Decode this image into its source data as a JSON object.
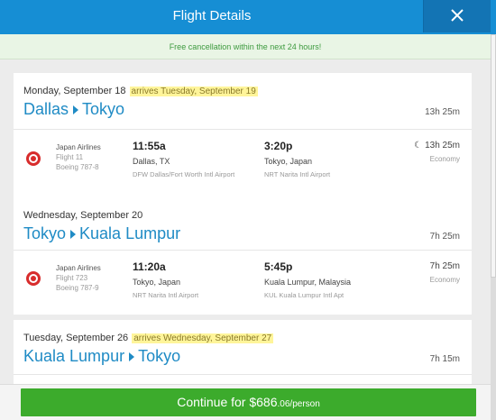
{
  "header": {
    "title": "Flight Details",
    "close_icon": "close-icon"
  },
  "notice": {
    "text": "Free cancellation within the next 24 hours!"
  },
  "cards": [
    {
      "date": "Monday, September 18",
      "arrives": "arrives Tuesday, September 19",
      "from": "Dallas",
      "to": "Tokyo",
      "duration": "13h 25m",
      "segment": {
        "airline": "Japan Airlines",
        "flight": "Flight 11",
        "aircraft": "Boeing 787-8",
        "dep_time": "11:55a",
        "dep_city": "Dallas, TX",
        "dep_airport": "DFW Dallas/Fort Worth Intl Airport",
        "arr_time": "3:20p",
        "arr_city": "Tokyo, Japan",
        "arr_airport": "NRT Narita Intl Airport",
        "duration": "13h 25m",
        "overnight_icon": "moon-icon",
        "cabin": "Economy"
      }
    },
    {
      "date": "Wednesday, September 20",
      "from": "Tokyo",
      "to": "Kuala Lumpur",
      "duration": "7h 25m",
      "segment": {
        "airline": "Japan Airlines",
        "flight": "Flight 723",
        "aircraft": "Boeing 787-9",
        "dep_time": "11:20a",
        "dep_city": "Tokyo, Japan",
        "dep_airport": "NRT Narita Intl Airport",
        "arr_time": "5:45p",
        "arr_city": "Kuala Lumpur, Malaysia",
        "arr_airport": "KUL Kuala Lumpur Intl Apt",
        "duration": "7h 25m",
        "cabin": "Economy"
      }
    },
    {
      "date": "Tuesday, September 26",
      "arrives": "arrives Wednesday, September 27",
      "from": "Kuala Lumpur",
      "to": "Tokyo",
      "duration": "7h 15m"
    }
  ],
  "footer": {
    "button_main": "Continue for $686",
    "button_cents": ".06/person"
  },
  "colors": {
    "header": "#168ed4",
    "accent_blue": "#1f8bc5",
    "button_green": "#3cab2c",
    "notice_green": "#3d9a3f",
    "highlight": "#fff59a"
  }
}
